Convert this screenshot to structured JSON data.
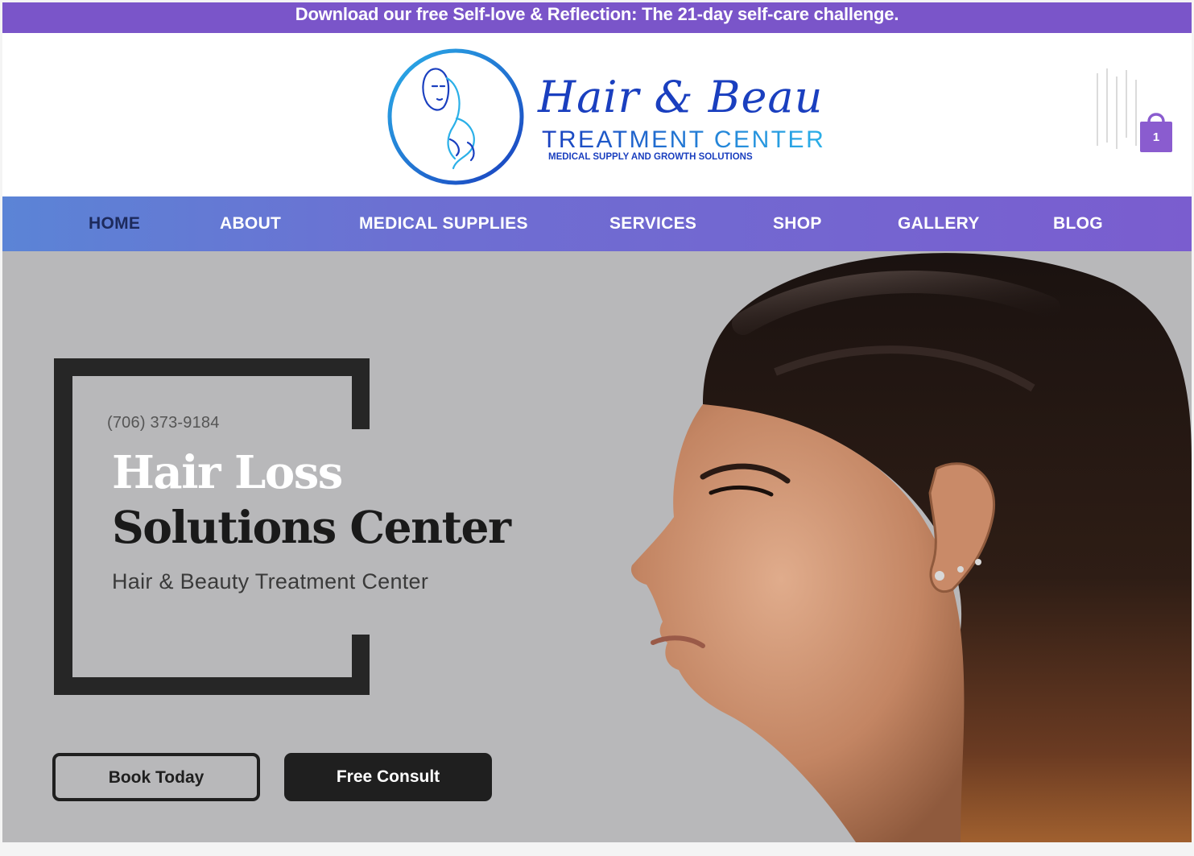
{
  "promo": {
    "text": "Download our free Self-love & Reflection: The 21-day self-care challenge."
  },
  "header": {
    "logo": {
      "script_line": "Hair & Beauty",
      "main_line": "TREATMENT CENTER",
      "tagline": "MEDICAL SUPPLY AND GROWTH SOLUTIONS"
    },
    "cart": {
      "count": "1",
      "icon": "shopping-bag-icon"
    }
  },
  "nav": {
    "items": [
      {
        "label": "HOME",
        "active": true
      },
      {
        "label": "ABOUT",
        "active": false
      },
      {
        "label": "MEDICAL SUPPLIES",
        "active": false
      },
      {
        "label": "SERVICES",
        "active": false
      },
      {
        "label": "SHOP",
        "active": false
      },
      {
        "label": "GALLERY",
        "active": false
      },
      {
        "label": "BLOG",
        "active": false
      }
    ]
  },
  "hero": {
    "phone": "(706) 373-9184",
    "title_line1": "Hair Loss",
    "title_line2": "Solutions Center",
    "subtitle": "Hair & Beauty Treatment Center",
    "buttons": {
      "book": "Book Today",
      "consult": "Free Consult"
    }
  },
  "colors": {
    "promo_bg": "#7a55c9",
    "nav_gradient_start": "#5b84d6",
    "nav_gradient_end": "#7a5dcf",
    "nav_active": "#1d2a5c",
    "hero_bg": "#b8b8ba",
    "logo_blue": "#1a3fbf",
    "logo_cyan": "#2bb0e8",
    "dark": "#1f1f1f"
  }
}
